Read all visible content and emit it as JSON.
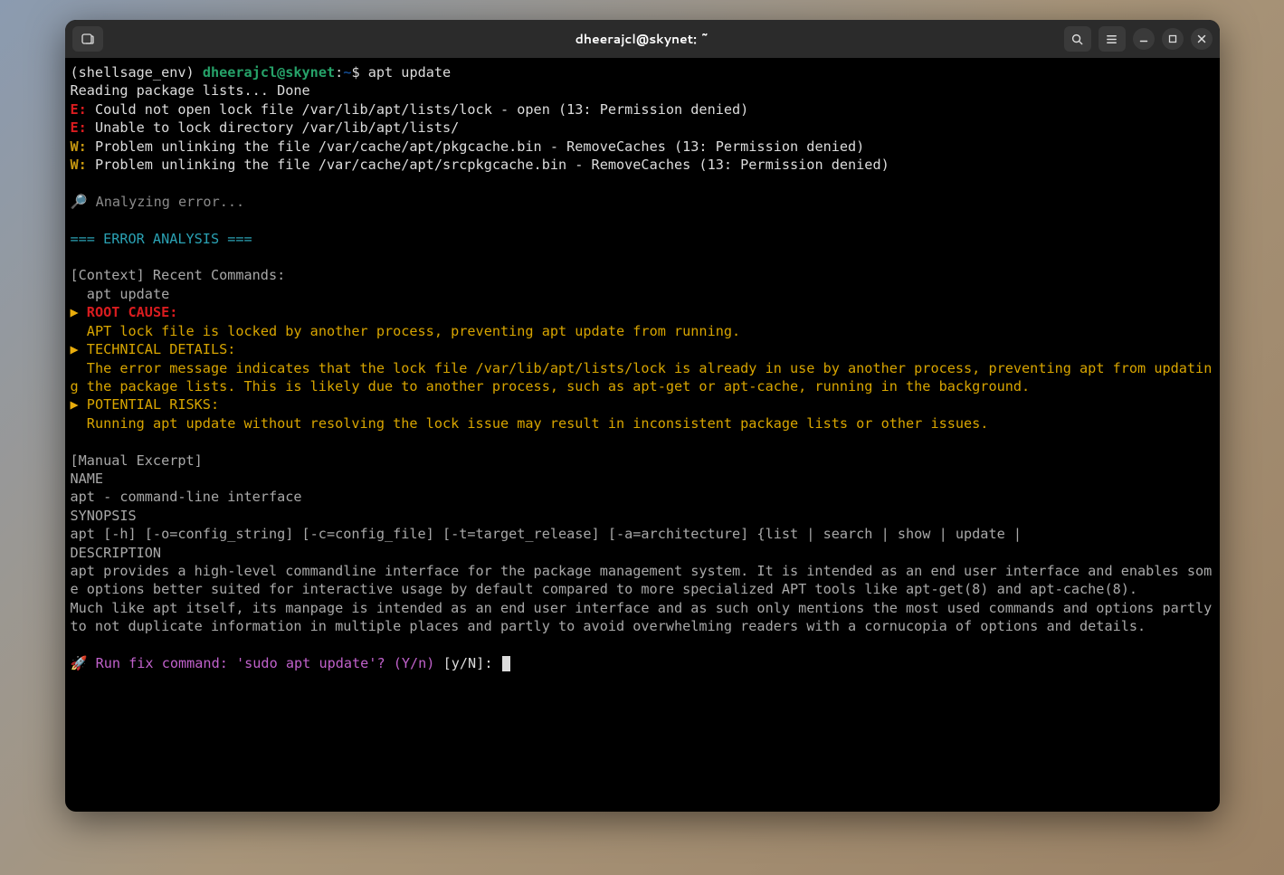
{
  "titlebar": {
    "title": "dheerajcl@skynet: ~"
  },
  "prompt": {
    "env": "(shellsage_env) ",
    "userhost": "dheerajcl@skynet",
    "colon": ":",
    "path": "~",
    "dollar": "$ ",
    "command": "apt update"
  },
  "output": {
    "reading": "Reading package lists... Done",
    "e1_prefix": "E:",
    "e1_msg": " Could not open lock file /var/lib/apt/lists/lock - open (13: Permission denied)",
    "e2_prefix": "E:",
    "e2_msg": " Unable to lock directory /var/lib/apt/lists/",
    "w1_prefix": "W:",
    "w1_msg": " Problem unlinking the file /var/cache/apt/pkgcache.bin - RemoveCaches (13: Permission denied)",
    "w2_prefix": "W:",
    "w2_msg": " Problem unlinking the file /var/cache/apt/srcpkgcache.bin - RemoveCaches (13: Permission denied)"
  },
  "analyzing": {
    "icon": "🔎 ",
    "text": "Analyzing error..."
  },
  "header": "=== ERROR ANALYSIS ===",
  "context": {
    "label": "[Context] Recent Commands:",
    "cmd": "  apt update"
  },
  "root_cause": {
    "bullet": "▶ ",
    "label": "ROOT CAUSE:",
    "detail": "  APT lock file is locked by another process, preventing apt update from running."
  },
  "technical": {
    "bullet": "▶ ",
    "label": "TECHNICAL DETAILS:",
    "detail": "  The error message indicates that the lock file /var/lib/apt/lists/lock is already in use by another process, preventing apt from updating the package lists. This is likely due to another process, such as apt-get or apt-cache, running in the background."
  },
  "risks": {
    "bullet": "▶ ",
    "label": "POTENTIAL RISKS:",
    "detail": "  Running apt update without resolving the lock issue may result in inconsistent package lists or other issues."
  },
  "manual": {
    "label": "[Manual Excerpt]",
    "name": "NAME",
    "name_line": "apt - command-line interface",
    "synopsis": "SYNOPSIS",
    "synopsis_line": "apt [-h] [-o=config_string] [-c=config_file] [-t=target_release] [-a=architecture] {list | search | show | update |",
    "description": "DESCRIPTION",
    "desc_para": "apt provides a high-level commandline interface for the package management system. It is intended as an end user interface and enables some options better suited for interactive usage by default compared to more specialized APT tools like apt-get(8) and apt-cache(8).\nMuch like apt itself, its manpage is intended as an end user interface and as such only mentions the most used commands and options partly to not duplicate information in multiple places and partly to avoid overwhelming readers with a cornucopia of options and details."
  },
  "fix": {
    "icon": "🚀 ",
    "prompt": "Run fix command: 'sudo apt update'? (Y/n)",
    "bracket": " [y/N]: "
  }
}
